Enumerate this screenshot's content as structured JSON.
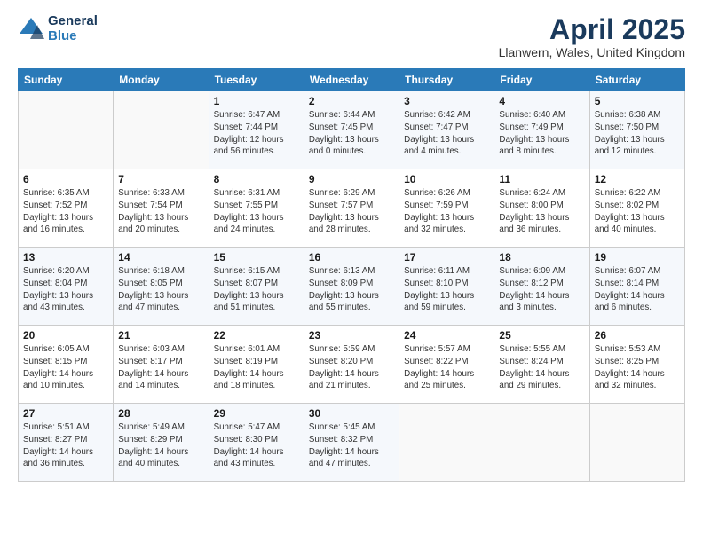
{
  "logo": {
    "general": "General",
    "blue": "Blue"
  },
  "title": {
    "month": "April 2025",
    "location": "Llanwern, Wales, United Kingdom"
  },
  "weekdays": [
    "Sunday",
    "Monday",
    "Tuesday",
    "Wednesday",
    "Thursday",
    "Friday",
    "Saturday"
  ],
  "weeks": [
    [
      {
        "day": "",
        "info": ""
      },
      {
        "day": "",
        "info": ""
      },
      {
        "day": "1",
        "info": "Sunrise: 6:47 AM\nSunset: 7:44 PM\nDaylight: 12 hours and 56 minutes."
      },
      {
        "day": "2",
        "info": "Sunrise: 6:44 AM\nSunset: 7:45 PM\nDaylight: 13 hours and 0 minutes."
      },
      {
        "day": "3",
        "info": "Sunrise: 6:42 AM\nSunset: 7:47 PM\nDaylight: 13 hours and 4 minutes."
      },
      {
        "day": "4",
        "info": "Sunrise: 6:40 AM\nSunset: 7:49 PM\nDaylight: 13 hours and 8 minutes."
      },
      {
        "day": "5",
        "info": "Sunrise: 6:38 AM\nSunset: 7:50 PM\nDaylight: 13 hours and 12 minutes."
      }
    ],
    [
      {
        "day": "6",
        "info": "Sunrise: 6:35 AM\nSunset: 7:52 PM\nDaylight: 13 hours and 16 minutes."
      },
      {
        "day": "7",
        "info": "Sunrise: 6:33 AM\nSunset: 7:54 PM\nDaylight: 13 hours and 20 minutes."
      },
      {
        "day": "8",
        "info": "Sunrise: 6:31 AM\nSunset: 7:55 PM\nDaylight: 13 hours and 24 minutes."
      },
      {
        "day": "9",
        "info": "Sunrise: 6:29 AM\nSunset: 7:57 PM\nDaylight: 13 hours and 28 minutes."
      },
      {
        "day": "10",
        "info": "Sunrise: 6:26 AM\nSunset: 7:59 PM\nDaylight: 13 hours and 32 minutes."
      },
      {
        "day": "11",
        "info": "Sunrise: 6:24 AM\nSunset: 8:00 PM\nDaylight: 13 hours and 36 minutes."
      },
      {
        "day": "12",
        "info": "Sunrise: 6:22 AM\nSunset: 8:02 PM\nDaylight: 13 hours and 40 minutes."
      }
    ],
    [
      {
        "day": "13",
        "info": "Sunrise: 6:20 AM\nSunset: 8:04 PM\nDaylight: 13 hours and 43 minutes."
      },
      {
        "day": "14",
        "info": "Sunrise: 6:18 AM\nSunset: 8:05 PM\nDaylight: 13 hours and 47 minutes."
      },
      {
        "day": "15",
        "info": "Sunrise: 6:15 AM\nSunset: 8:07 PM\nDaylight: 13 hours and 51 minutes."
      },
      {
        "day": "16",
        "info": "Sunrise: 6:13 AM\nSunset: 8:09 PM\nDaylight: 13 hours and 55 minutes."
      },
      {
        "day": "17",
        "info": "Sunrise: 6:11 AM\nSunset: 8:10 PM\nDaylight: 13 hours and 59 minutes."
      },
      {
        "day": "18",
        "info": "Sunrise: 6:09 AM\nSunset: 8:12 PM\nDaylight: 14 hours and 3 minutes."
      },
      {
        "day": "19",
        "info": "Sunrise: 6:07 AM\nSunset: 8:14 PM\nDaylight: 14 hours and 6 minutes."
      }
    ],
    [
      {
        "day": "20",
        "info": "Sunrise: 6:05 AM\nSunset: 8:15 PM\nDaylight: 14 hours and 10 minutes."
      },
      {
        "day": "21",
        "info": "Sunrise: 6:03 AM\nSunset: 8:17 PM\nDaylight: 14 hours and 14 minutes."
      },
      {
        "day": "22",
        "info": "Sunrise: 6:01 AM\nSunset: 8:19 PM\nDaylight: 14 hours and 18 minutes."
      },
      {
        "day": "23",
        "info": "Sunrise: 5:59 AM\nSunset: 8:20 PM\nDaylight: 14 hours and 21 minutes."
      },
      {
        "day": "24",
        "info": "Sunrise: 5:57 AM\nSunset: 8:22 PM\nDaylight: 14 hours and 25 minutes."
      },
      {
        "day": "25",
        "info": "Sunrise: 5:55 AM\nSunset: 8:24 PM\nDaylight: 14 hours and 29 minutes."
      },
      {
        "day": "26",
        "info": "Sunrise: 5:53 AM\nSunset: 8:25 PM\nDaylight: 14 hours and 32 minutes."
      }
    ],
    [
      {
        "day": "27",
        "info": "Sunrise: 5:51 AM\nSunset: 8:27 PM\nDaylight: 14 hours and 36 minutes."
      },
      {
        "day": "28",
        "info": "Sunrise: 5:49 AM\nSunset: 8:29 PM\nDaylight: 14 hours and 40 minutes."
      },
      {
        "day": "29",
        "info": "Sunrise: 5:47 AM\nSunset: 8:30 PM\nDaylight: 14 hours and 43 minutes."
      },
      {
        "day": "30",
        "info": "Sunrise: 5:45 AM\nSunset: 8:32 PM\nDaylight: 14 hours and 47 minutes."
      },
      {
        "day": "",
        "info": ""
      },
      {
        "day": "",
        "info": ""
      },
      {
        "day": "",
        "info": ""
      }
    ]
  ]
}
